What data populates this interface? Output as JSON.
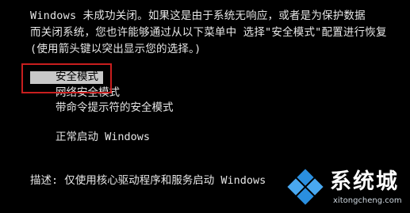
{
  "intro": {
    "line1": "Windows 未成功关闭。如果这是由于系统无响应，或者是为保护数据",
    "line2": "而关闭系统，您也许能够通过从以下菜单中 选择\"安全模式\"配置进行恢复",
    "line3": "(使用箭头键以突出显示您的选择。)"
  },
  "menu": {
    "items": [
      {
        "label": "安全模式",
        "selected": true
      },
      {
        "label": "网络安全模式",
        "selected": false
      },
      {
        "label": "带命令提示符的安全模式",
        "selected": false
      },
      {
        "label": "正常启动 Windows",
        "selected": false
      }
    ]
  },
  "description": "描述: 仅使用核心驱动程序和服务启动 Windows",
  "watermark": {
    "title": "系统城",
    "url": "xitongcheng.com",
    "logo_icon": "windows-diamond-logo-icon"
  },
  "colors": {
    "background": "#000000",
    "text": "#e6e6e6",
    "highlight": "#c8c8c8",
    "annotation": "#c81e1e",
    "logo_blue": "#2a8fe0"
  }
}
